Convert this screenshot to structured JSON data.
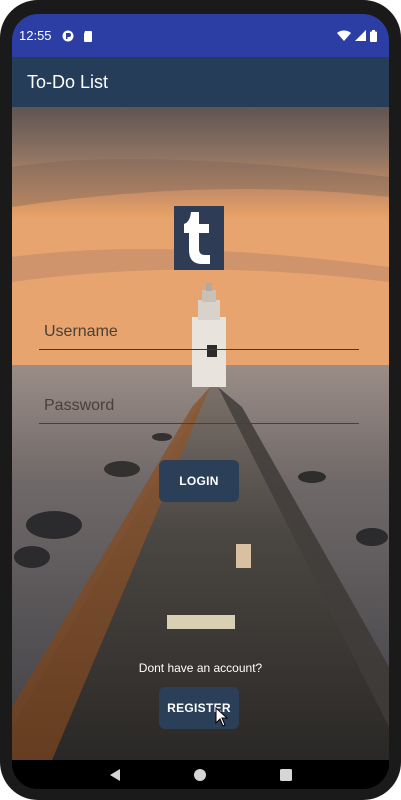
{
  "status_bar": {
    "time": "12:55",
    "icons": [
      "pocket-casts-icon",
      "sd-card-icon",
      "wifi-icon",
      "signal-icon",
      "battery-icon"
    ]
  },
  "app_bar": {
    "title": "To-Do List"
  },
  "login_form": {
    "username_placeholder": "Username",
    "password_placeholder": "Password",
    "login_label": "LOGIN",
    "register_prompt": "Dont have an account?",
    "register_label": "REGISTER"
  },
  "logo": {
    "letter": "t"
  },
  "colors": {
    "status_bar": "#2c3ea3",
    "app_bar": "#263d5a",
    "button": "#2b3f58"
  },
  "nav_bar": {
    "icons": [
      "back-icon",
      "home-icon",
      "recents-icon"
    ]
  }
}
